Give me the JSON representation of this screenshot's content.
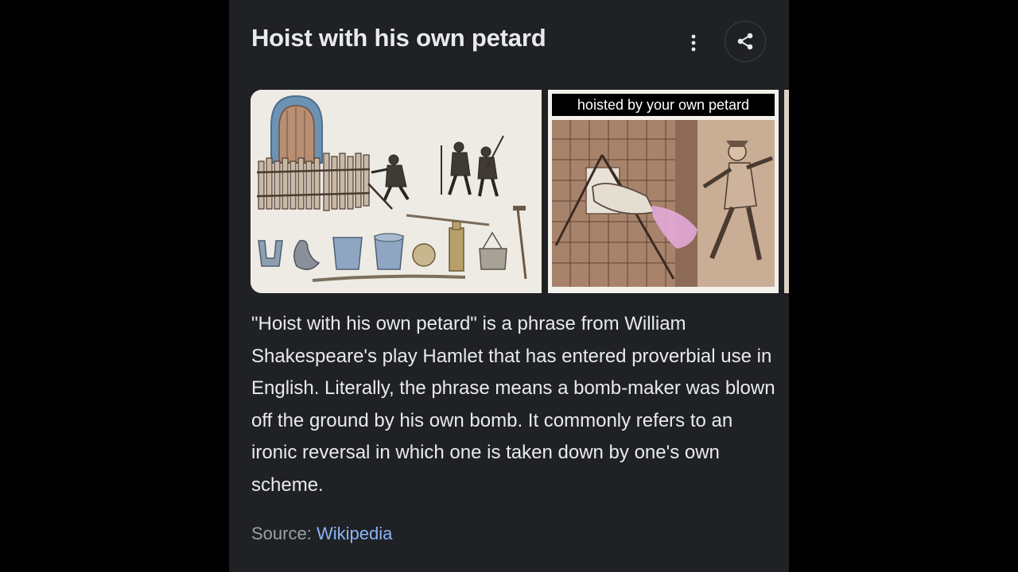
{
  "header": {
    "title": "Hoist with his own petard",
    "more_icon": "more-vert-icon",
    "share_icon": "share-icon"
  },
  "gallery": {
    "images": [
      {
        "label": "petard-equipment-engraving"
      },
      {
        "caption": "hoisted by your own petard"
      }
    ]
  },
  "description": "\"Hoist with his own petard\" is a phrase from William Shakespeare's play Hamlet that has entered proverbial use in English. Literally, the phrase means a bomb-maker was blown off the ground by his own bomb. It commonly refers to an ironic reversal in which one is taken down by one's own scheme.",
  "source": {
    "label": "Source:",
    "link_text": "Wikipedia"
  },
  "colors": {
    "background": "#000000",
    "panel": "#202124",
    "text": "#e8eaed",
    "muted": "#9aa0a6",
    "link": "#8ab4f8"
  }
}
